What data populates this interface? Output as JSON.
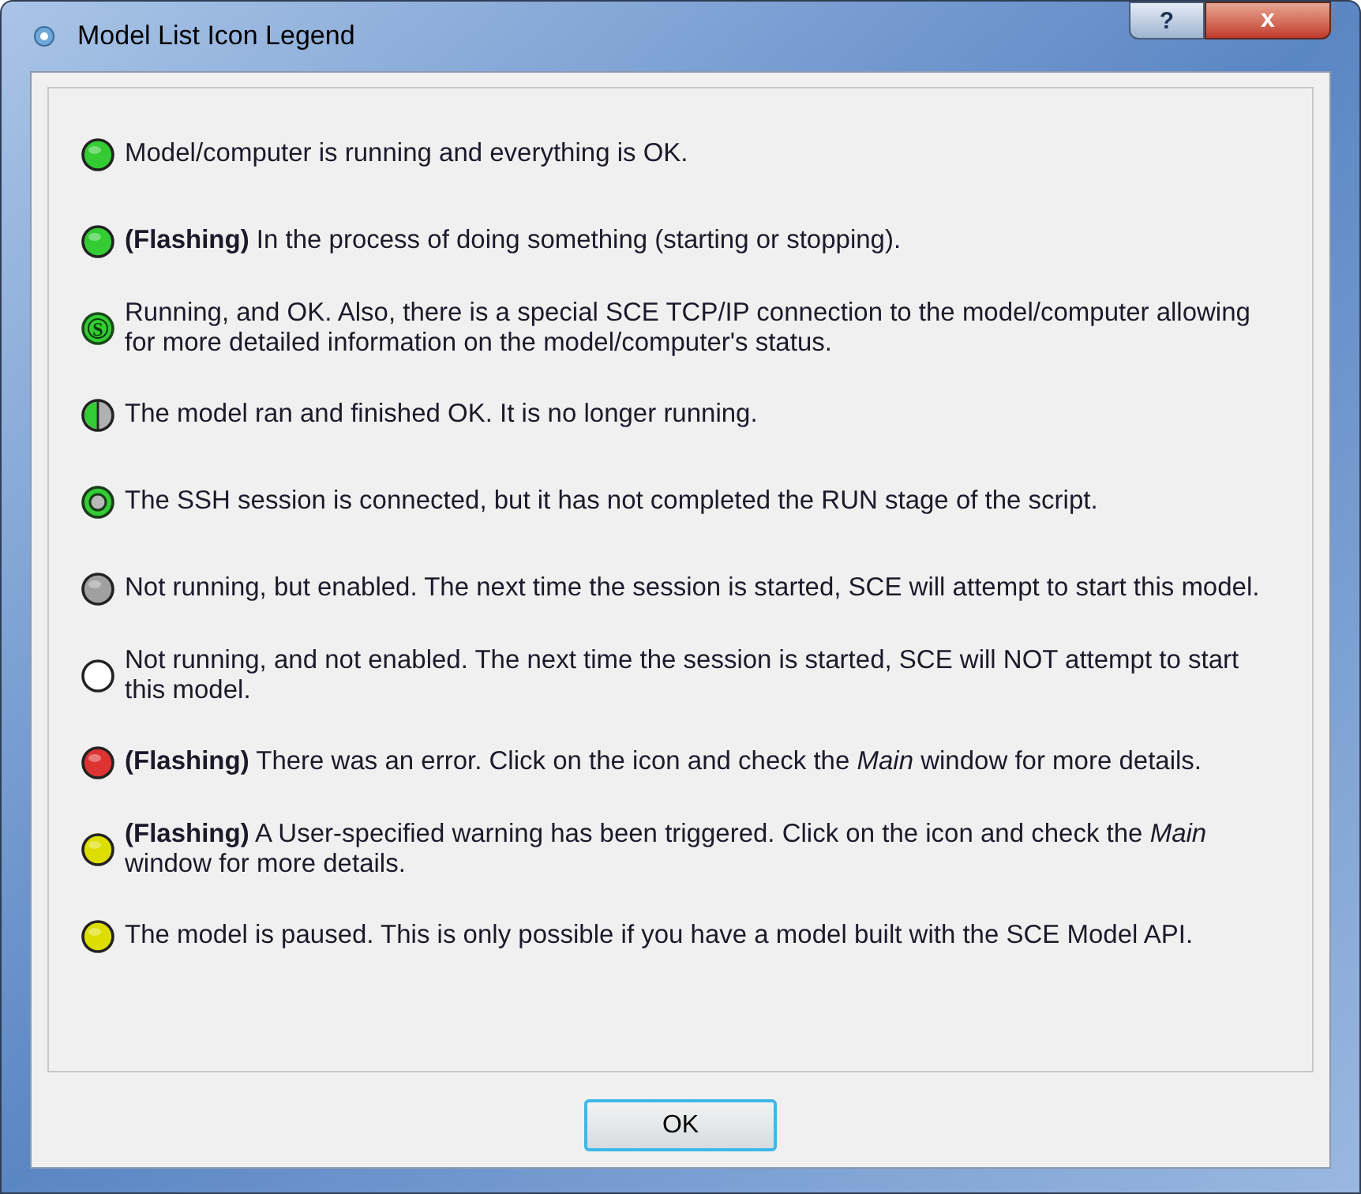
{
  "window": {
    "title": "Model List Icon Legend",
    "buttons": [
      "?",
      "x"
    ]
  },
  "legend": [
    {
      "kind": "plain",
      "color": "#33cc33",
      "text": "Model/computer is running and everything is OK."
    },
    {
      "kind": "plain",
      "color": "#33cc33",
      "text": "**(Flashing)** In the process of doing something (starting or stopping)."
    },
    {
      "kind": "letter",
      "color": "#33cc33",
      "letter": "S",
      "text": "Running, and OK. Also, there is a special SCE TCP/IP connection to the model/computer allowing for more detailed information on the model/computer's status."
    },
    {
      "kind": "half",
      "color": "#33cc33",
      "text": "The model ran and finished OK. It is no longer running."
    },
    {
      "kind": "ring",
      "color": "#33cc33",
      "text": "The SSH session is connected, but it has not completed the RUN stage of the script."
    },
    {
      "kind": "plain",
      "color": "#a0a0a0",
      "text": "Not running, but enabled. The next time the session is started, SCE will attempt to start this model."
    },
    {
      "kind": "plain",
      "color": "#ffffff",
      "text": "Not running, and not enabled. The next time the session is started, SCE will NOT attempt to start this model."
    },
    {
      "kind": "plain",
      "color": "#dd3333",
      "text": "**(Flashing)** There was an error. Click on the icon and check the *Main* window for more details."
    },
    {
      "kind": "plain",
      "color": "#dddd00",
      "text": "**(Flashing)** A User-specified warning has been triggered. Click on the icon and check the *Main* window for more details."
    },
    {
      "kind": "plain",
      "color": "#dddd00",
      "text": "The model is paused. This is only possible if you have a model built with the SCE Model API."
    }
  ],
  "ok_button": "OK"
}
